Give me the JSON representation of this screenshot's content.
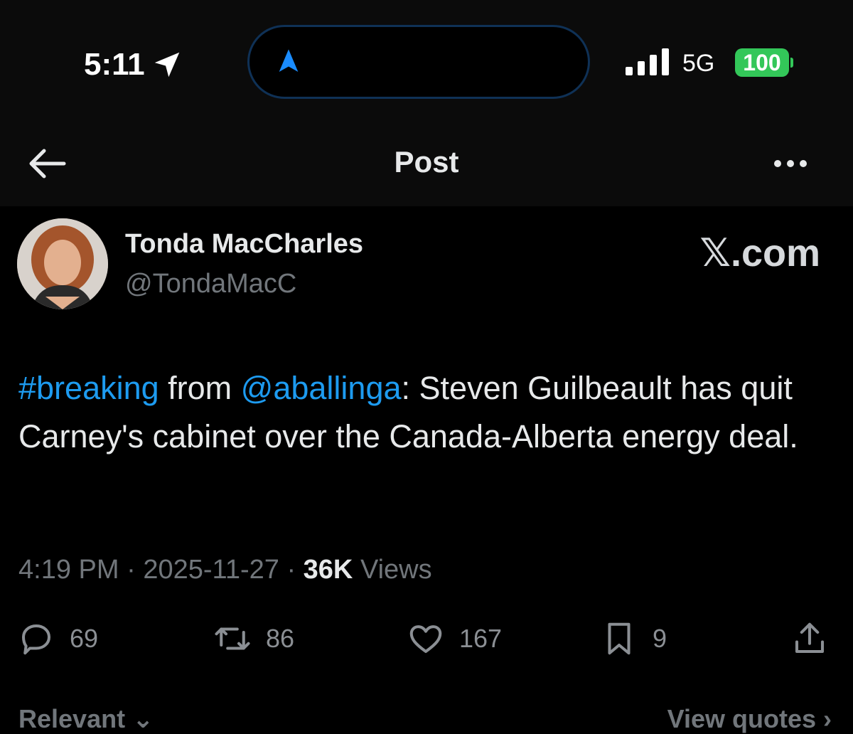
{
  "status_bar": {
    "time": "5:11",
    "network": "5G",
    "battery": "100",
    "icons": [
      "location-arrow-icon",
      "navigation-arrow-icon",
      "signal-bars-icon"
    ]
  },
  "header": {
    "title": "Post",
    "back_icon": "back-arrow-icon",
    "more_icon": "more-dots-icon"
  },
  "post": {
    "author_name": "Tonda MacCharles",
    "author_handle": "@TondaMacC",
    "brand": "𝕏.com",
    "text_hashtag": "#breaking",
    "text_from": " from ",
    "text_mention": "@aballinga",
    "text_body": ": Steven Guilbeault has quit Carney's cabinet over the Canada-Alberta energy deal.",
    "time": "4:19 PM",
    "date": "2025-11-27",
    "views_count": "36K",
    "views_label": "Views",
    "separator": "·"
  },
  "actions": {
    "replies": "69",
    "reposts": "86",
    "likes": "167",
    "bookmarks": "9"
  },
  "footer": {
    "sort_label": "Relevant",
    "quotes_label": "View quotes"
  },
  "colors": {
    "background": "#000000",
    "link": "#1d9bf0",
    "muted": "#71767b",
    "battery": "#33c759"
  }
}
